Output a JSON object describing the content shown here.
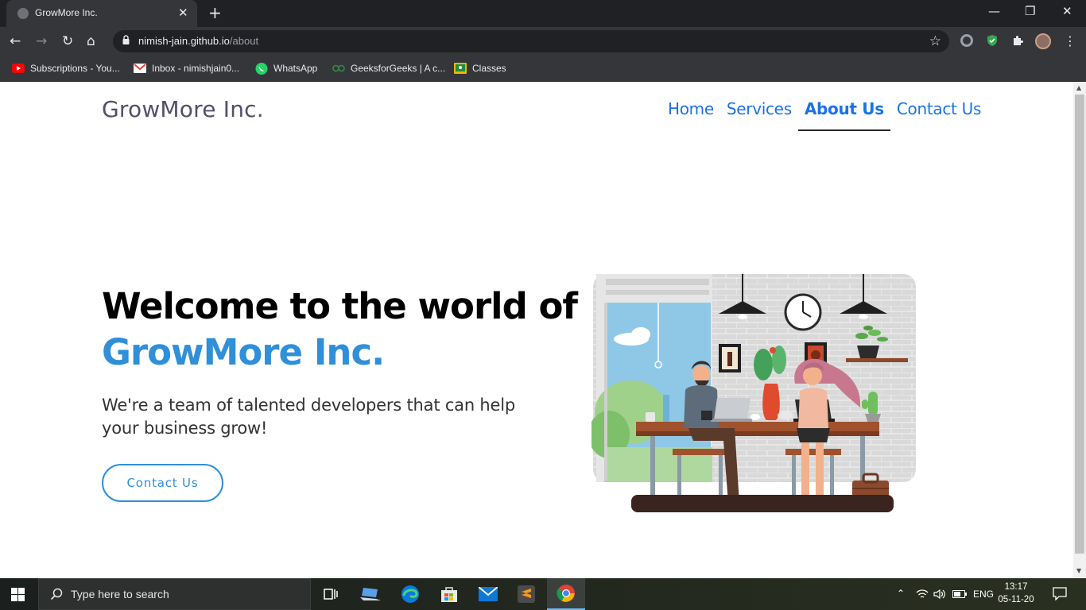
{
  "browser": {
    "tab_title": "GrowMore Inc.",
    "tab_close": "✕",
    "new_tab": "+",
    "window_controls": {
      "minimize": "—",
      "restore": "❐",
      "close": "✕"
    },
    "nav": {
      "back": "←",
      "forward": "→",
      "reload": "↻",
      "home": "⌂"
    },
    "url_host": "nimish-jain.github.io",
    "url_path": "/about",
    "star": "☆",
    "menu": "⋮",
    "bookmarks": [
      {
        "label": "Subscriptions - You...",
        "icon": "youtube-icon",
        "color": "#ff0000"
      },
      {
        "label": "Inbox - nimishjain0...",
        "icon": "gmail-icon",
        "color": "#ea4335"
      },
      {
        "label": "WhatsApp",
        "icon": "whatsapp-icon",
        "color": "#25d366"
      },
      {
        "label": "GeeksforGeeks | A c...",
        "icon": "geeksforgeeks-icon",
        "color": "#2f8d46"
      },
      {
        "label": "Classes",
        "icon": "google-classroom-icon",
        "color": "#f4b400"
      }
    ]
  },
  "page": {
    "brand": "GrowMore Inc.",
    "nav": [
      {
        "label": "Home",
        "active": false
      },
      {
        "label": "Services",
        "active": false
      },
      {
        "label": "About Us",
        "active": true
      },
      {
        "label": "Contact Us",
        "active": false
      }
    ],
    "hero": {
      "heading_line1": "Welcome to the world of",
      "heading_brand": "GrowMore Inc.",
      "subtext": "We're a team of talented developers that can help your business grow!",
      "cta_label": "Contact Us"
    },
    "colors": {
      "nav_link": "#1a73e8",
      "accent": "#2f8fd8",
      "brand_text": "#51506b"
    }
  },
  "taskbar": {
    "search_placeholder": "Type here to search",
    "apps": [
      "task-view-icon",
      "laptop-icon",
      "edge-icon",
      "store-icon",
      "mail-icon",
      "sublime-text-icon",
      "chrome-icon"
    ],
    "language": "ENG",
    "time": "13:17",
    "date": "05-11-20"
  }
}
